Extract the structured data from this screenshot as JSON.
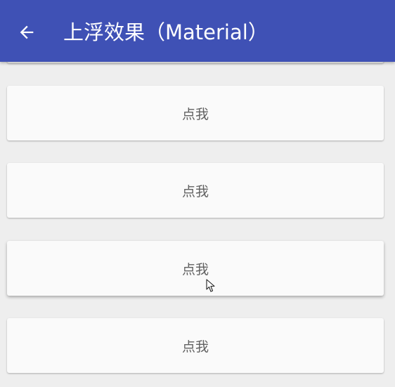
{
  "toolbar": {
    "title": "上浮效果（Material）",
    "background": "#3f51b5",
    "back_icon": "arrow-back-icon"
  },
  "cards": [
    {
      "label": "点我"
    },
    {
      "label": "点我"
    },
    {
      "label": "点我"
    },
    {
      "label": "点我"
    }
  ],
  "colors": {
    "background": "#eeeeee",
    "card": "#fafafa",
    "card_text": "#616161"
  },
  "cursor_icon": "mouse-pointer-icon"
}
